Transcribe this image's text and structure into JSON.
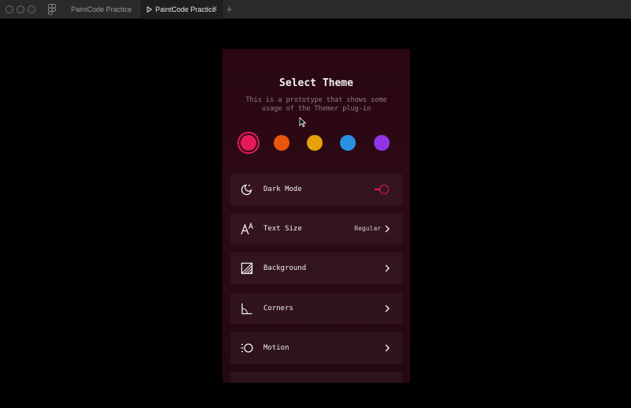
{
  "window": {
    "tabs": [
      {
        "label": "PaintCode Practice",
        "active": false
      },
      {
        "label": "PaintCode Practice",
        "active": true
      }
    ],
    "close_glyph": "✕",
    "new_tab_glyph": "+"
  },
  "theme": {
    "title": "Select Theme",
    "subtitle": "This is a prototype that shows some usage of the Themer plug-in",
    "swatches": [
      {
        "color": "#e6195a",
        "selected": true
      },
      {
        "color": "#e8560c"
      },
      {
        "color": "#e7a20b"
      },
      {
        "color": "#2b8fe3"
      },
      {
        "color": "#9034e6"
      }
    ],
    "accent": "#e6195a"
  },
  "settings": [
    {
      "label": "Dark Mode",
      "icon": "moon-icon",
      "control": "toggle",
      "on": true
    },
    {
      "label": "Text Size",
      "icon": "text-size-icon",
      "value": "Regular"
    },
    {
      "label": "Background",
      "icon": "background-icon"
    },
    {
      "label": "Corners",
      "icon": "corners-icon"
    },
    {
      "label": "Motion",
      "icon": "motion-icon"
    }
  ]
}
